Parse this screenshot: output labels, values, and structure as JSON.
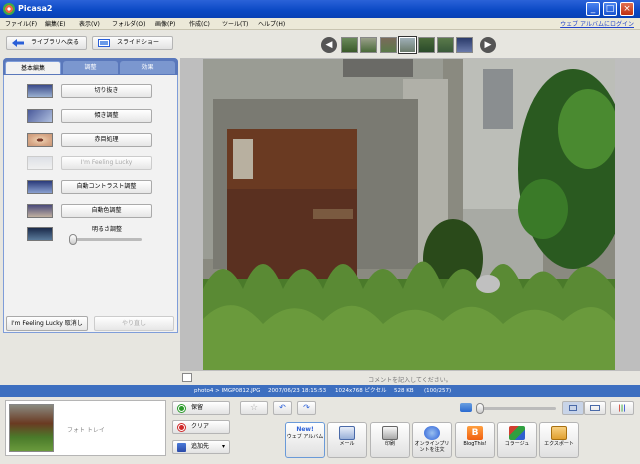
{
  "window": {
    "title": "Picasa2"
  },
  "menu": {
    "items": [
      "ファイル(F)",
      "編集(E)",
      "表示(V)",
      "フォルダ(O)",
      "画像(P)",
      "作成(C)",
      "ツール(T)",
      "ヘルプ(H)"
    ],
    "web_link": "ウェブ アルバムにログイン"
  },
  "toolbar": {
    "back_label": "ライブラリへ戻る",
    "slideshow_label": "スライドショー"
  },
  "tabs": [
    "基本編集",
    "調整",
    "効果"
  ],
  "tools": [
    "切り抜き",
    "傾き調整",
    "赤目処理",
    "I'm Feeling Lucky",
    "自動コントラスト調整",
    "自動色調整"
  ],
  "fill_light": {
    "label": "明るさ調整",
    "value": 0
  },
  "lucky_undo_label": "I'm Feeling Lucky 取消し",
  "redo_label": "やり直し",
  "comment_placeholder": "コメントを記入してください。",
  "info": {
    "name": "photo4 > IMGP0812.JPG",
    "date": "2007/06/23 18:15:53",
    "dims": "1024x768 ピクセル",
    "size": "528 KB",
    "index": "(100/257)"
  },
  "tray": {
    "label": "フォト トレイ",
    "hold": "保留",
    "clear": "クリア",
    "add": "追加先"
  },
  "actions": [
    {
      "label": "ウェブ アルバム",
      "badge": "New!"
    },
    {
      "label": "メール"
    },
    {
      "label": "印刷"
    },
    {
      "label": "オンラインプリントを注文"
    },
    {
      "label": "BlogThis!"
    },
    {
      "label": "コラージュ"
    },
    {
      "label": "エクスポート"
    }
  ],
  "colors": {
    "title_bar": "#0a48c4",
    "info_bar": "#3d6fc0",
    "accent": "#5a78bb"
  }
}
